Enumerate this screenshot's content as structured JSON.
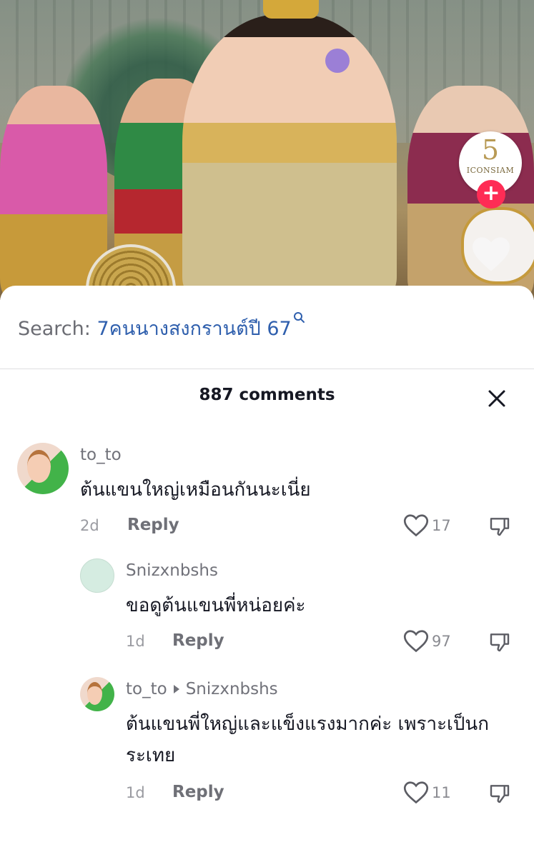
{
  "video": {
    "badge_number": "5",
    "badge_text": "ICONSIAM",
    "follow_symbol": "+"
  },
  "search": {
    "prefix": "Search: ",
    "query": "7คนนางสงกรานต์ปี 67"
  },
  "comments_header": {
    "count_label": "887 comments"
  },
  "comments": [
    {
      "username": "to_to",
      "text": "ต้นแขนใหญ่เหมือนกันนะเนี่ย",
      "date": "2d",
      "reply_label": "Reply",
      "likes": "17"
    },
    {
      "username": "Snizxnbshs",
      "text": "ขอดูต้นแขนพี่หน่อยค่ะ",
      "date": "1d",
      "reply_label": "Reply",
      "likes": "97"
    },
    {
      "username": "to_to",
      "reply_to": "Snizxnbshs",
      "text_line1": "ต้นแขนพี่ใหญ่และแข็งแรงมากค่ะ เพราะเป็นก",
      "text_line2": "ระเทย",
      "date": "1d",
      "reply_label": "Reply",
      "likes": "11"
    }
  ],
  "colors": {
    "accent_red": "#fe2c55",
    "search_blue": "#2f5fad",
    "muted_text": "#71727a"
  },
  "icons": [
    "search-icon",
    "close-icon",
    "heart-icon",
    "dislike-icon",
    "reply-arrow-icon",
    "plus-icon"
  ]
}
